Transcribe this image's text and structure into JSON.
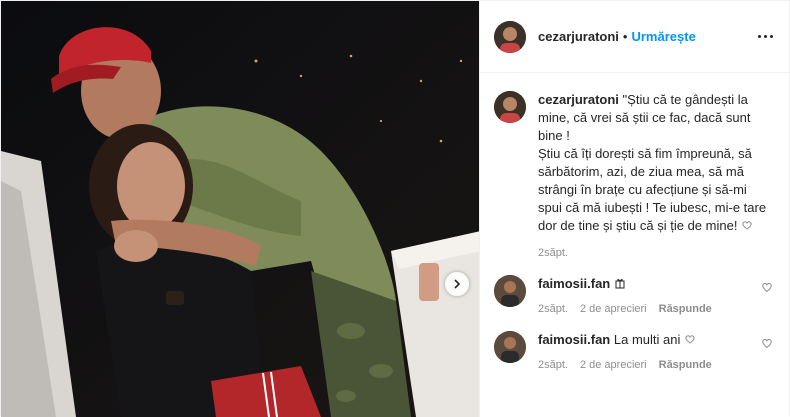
{
  "post": {
    "author": "cezarjuratoni",
    "follow_label": "Urmărește",
    "separator": "•",
    "caption": {
      "username": "cezarjuratoni",
      "text": "\"Știu că te gândești la mine, că vrei să știi ce fac, dacă sunt bine !\nȘtiu că îți dorești să fim împreună, să sărbătorim, azi, de ziua mea, să mă strângi în brațe cu afecțiune și să-mi spui că mă iubești ! Te iubesc, mi-e tare dor de tine și știu că și ție de mine!",
      "time": "2săpt."
    },
    "comments": [
      {
        "username": "faimosii.fan",
        "text": "",
        "time": "2săpt.",
        "likes": "2 de aprecieri",
        "reply": "Răspunde"
      },
      {
        "username": "faimosii.fan",
        "text": "La multi ani",
        "time": "2săpt.",
        "likes": "2 de aprecieri",
        "reply": "Răspunde"
      }
    ]
  },
  "icons": {
    "more": "more-options-icon",
    "next": "chevron-right-icon",
    "heart": "heart-outline-icon"
  },
  "colors": {
    "accent": "#0095f6",
    "muted": "#8e8e8e",
    "text": "#262626"
  }
}
